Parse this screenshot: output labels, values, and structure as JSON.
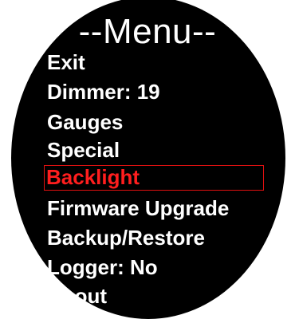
{
  "menu": {
    "title": "--Menu--",
    "items": [
      {
        "label": "Exit"
      },
      {
        "label": "Dimmer: 19"
      },
      {
        "label": "Gauges"
      },
      {
        "label": "Special"
      },
      {
        "label": "Backlight",
        "selected": true
      },
      {
        "label": "Firmware Upgrade"
      },
      {
        "label": "Backup/Restore"
      },
      {
        "label": "Logger: No"
      },
      {
        "label": "About"
      }
    ]
  },
  "colors": {
    "background": "#000000",
    "text": "#ffffff",
    "selected_text": "#ff1e1e",
    "selected_border": "#e01010"
  }
}
